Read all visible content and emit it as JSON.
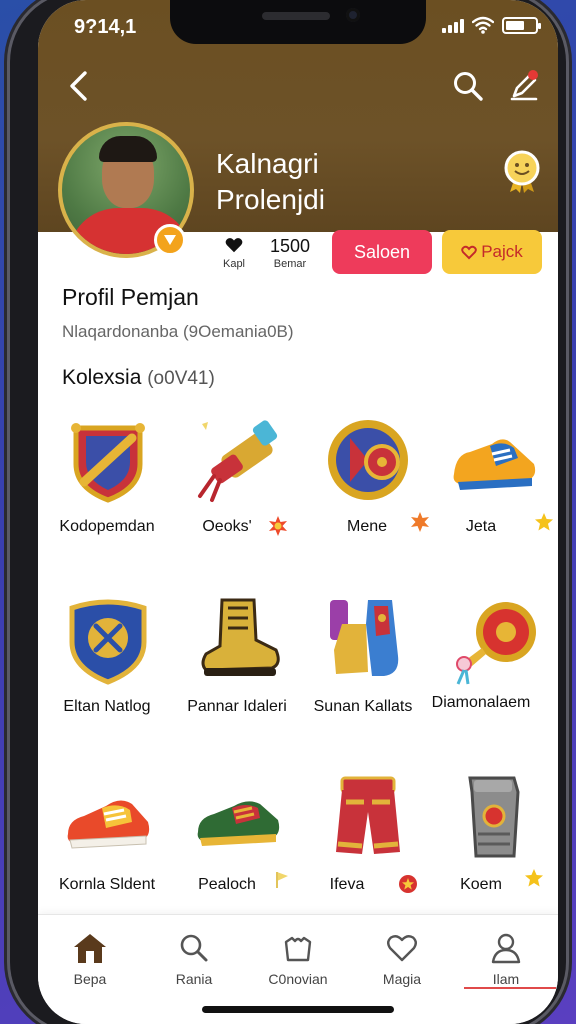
{
  "status_bar": {
    "time": "9?14,1"
  },
  "profile": {
    "name_line1": "Kalnagri",
    "name_line2": "Prolenjdi",
    "stats": [
      {
        "value": "",
        "label": "Kapl",
        "icon": "heart-icon"
      },
      {
        "value": "1500",
        "label": "Bemar"
      }
    ],
    "primary_button": "Saloen",
    "secondary_button": "Pajck"
  },
  "section": {
    "title": "Profil Pemjan",
    "subtitle": "Nlaqardonanba (9Oemania0B)"
  },
  "collection": {
    "title": "Kolexsia",
    "count": "(o0V41)",
    "items": [
      {
        "label": "Kodopemdan",
        "icon": "shield-crest-icon",
        "tag": ""
      },
      {
        "label": "Oeoks'",
        "icon": "scroll-cannon-icon",
        "tag": "burst"
      },
      {
        "label": "Mene",
        "icon": "drum-icon",
        "tag": "burst"
      },
      {
        "label": "Jeta",
        "icon": "sneaker-icon",
        "tag": "star"
      },
      {
        "label": "Eltan Natlog",
        "icon": "blue-shield-icon",
        "tag": ""
      },
      {
        "label": "Pannar Idaleri",
        "icon": "gold-boot-icon",
        "tag": ""
      },
      {
        "label": "Sunan Kallats",
        "icon": "leg-armor-icon",
        "tag": ""
      },
      {
        "label": "Diamonalaem",
        "icon": "medal-icon",
        "tag": ""
      },
      {
        "label": "Kornla Sldent",
        "icon": "running-shoe-icon",
        "tag": ""
      },
      {
        "label": "Pealoch",
        "icon": "green-shoe-icon",
        "tag": "flag"
      },
      {
        "label": "Ifeva",
        "icon": "pants-icon",
        "tag": "burst"
      },
      {
        "label": "Koem",
        "icon": "gauntlet-icon",
        "tag": "star"
      }
    ]
  },
  "bottom_nav": [
    {
      "label": "Bepa",
      "icon": "home-icon"
    },
    {
      "label": "Rania",
      "icon": "search-icon"
    },
    {
      "label": "C0novian",
      "icon": "bag-icon"
    },
    {
      "label": "Magia",
      "icon": "heart-icon"
    },
    {
      "label": "Ilam",
      "icon": "profile-icon"
    }
  ],
  "colors": {
    "header_brown": "#6b4f22",
    "primary_red": "#ee3b5b",
    "secondary_yellow": "#f7c93a",
    "active_line": "#e04a4a"
  }
}
